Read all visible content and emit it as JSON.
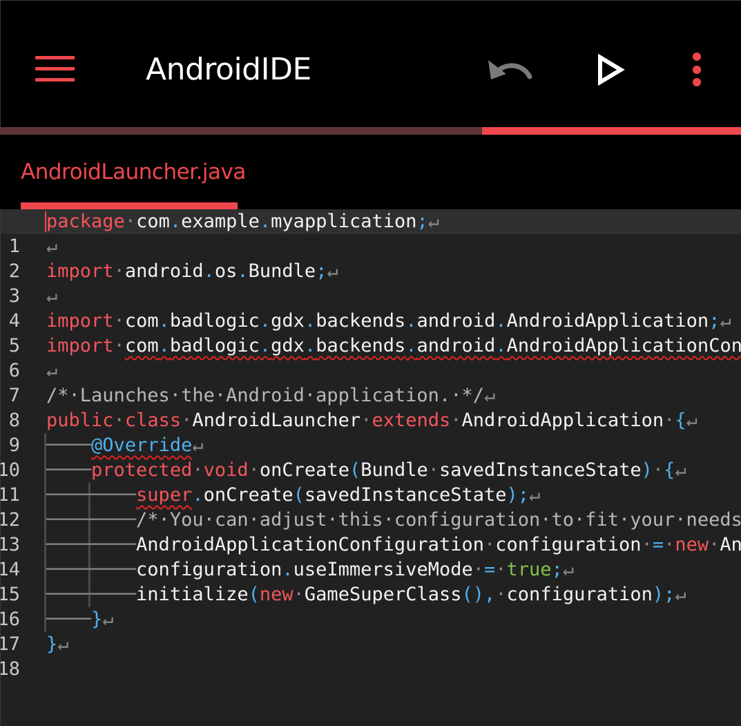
{
  "app": {
    "title": "AndroidIDE",
    "accent_color": "#f0474d",
    "icons": [
      "menu-icon",
      "undo-icon",
      "run-icon",
      "more-vert-icon"
    ],
    "progress_fraction": 0.35
  },
  "tab": {
    "label": "AndroidLauncher.java"
  },
  "editor": {
    "current_line": 1,
    "line_numbers": [
      "1",
      "2",
      "3",
      "4",
      "5",
      "6",
      "7",
      "8",
      "9",
      "10",
      "11",
      "12",
      "13",
      "14",
      "15",
      "16",
      "17",
      "18"
    ]
  }
}
